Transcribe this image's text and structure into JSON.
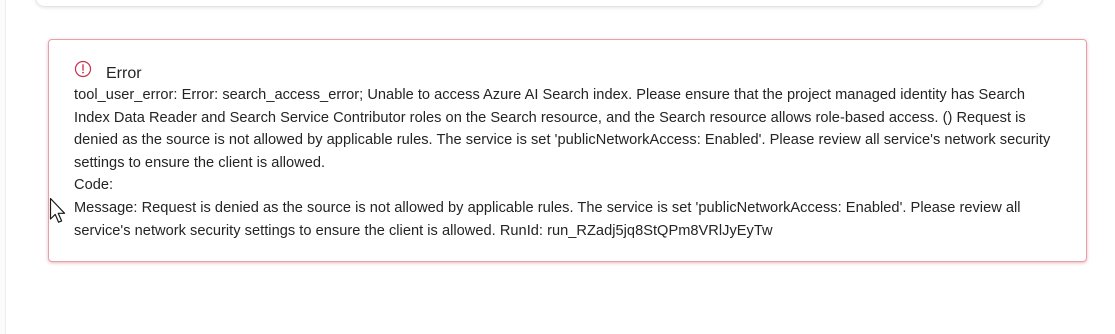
{
  "error": {
    "title": "Error",
    "message": "tool_user_error: Error: search_access_error; Unable to access Azure AI Search index. Please ensure that the project managed identity has Search Index Data Reader and Search Service Contributor roles on the Search resource, and the Search resource allows role-based access. () Request is denied as the source is not allowed by applicable rules. The service is set 'publicNetworkAccess: Enabled'. Please review all service's network security settings to ensure the client is allowed.\nCode:\nMessage: Request is denied as the source is not allowed by applicable rules. The service is set 'publicNetworkAccess: Enabled'. Please review all service's network security settings to ensure the client is allowed. RunId: run_RZadj5jq8StQPm8VRlJyEyTw",
    "icon": "error-circle-icon",
    "accent_color": "#c4314b"
  },
  "cursor": {
    "icon": "mouse-pointer-icon"
  }
}
